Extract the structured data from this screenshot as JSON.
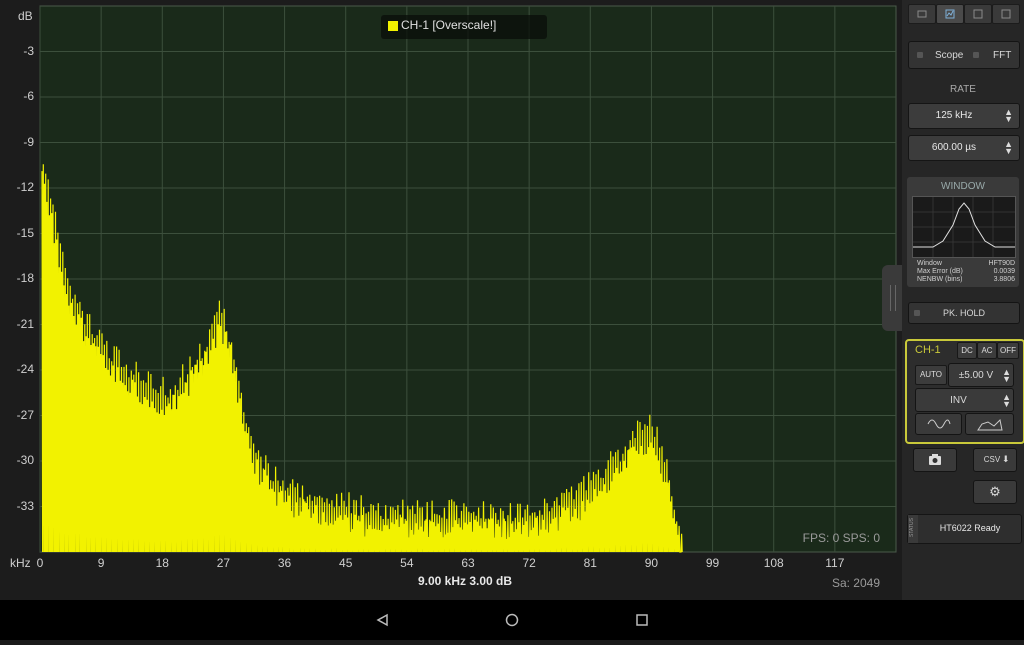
{
  "plot": {
    "y_unit": "dB",
    "x_unit": "kHz",
    "y_ticks": [
      "-3",
      "-6",
      "-9",
      "-12",
      "-15",
      "-18",
      "-21",
      "-24",
      "-27",
      "-30",
      "-33"
    ],
    "x_ticks": [
      "0",
      "9",
      "18",
      "27",
      "36",
      "45",
      "54",
      "63",
      "72",
      "81",
      "90",
      "99",
      "108",
      "117"
    ],
    "legend": "CH-1 [Overscale!]",
    "fps": "FPS: 0  SPS: 0",
    "cursor": "9.00 kHz  3.00 dB",
    "samples": "Sa: 2049",
    "trace_color": "#f2f200",
    "grid_color": "#3c4f3c",
    "background_color": "#1a2a1a"
  },
  "chart_data": {
    "type": "line",
    "xlabel": "kHz",
    "ylabel": "dB",
    "xlim": [
      0,
      126
    ],
    "ylim": [
      -36,
      0
    ],
    "series": [
      {
        "x": [
          0.5,
          2,
          4,
          7,
          10,
          13,
          16,
          19,
          22,
          25,
          26.5,
          28,
          31,
          34,
          37,
          40,
          43,
          46,
          49,
          52,
          55,
          58,
          61,
          64,
          67,
          70,
          73,
          76,
          79,
          82,
          85,
          88,
          89.5,
          91,
          93,
          94.5
        ],
        "y": [
          -9.6,
          -13,
          -17,
          -20,
          -22,
          -23,
          -24,
          -24.5,
          -23,
          -21,
          -19.2,
          -21,
          -28,
          -30,
          -31,
          -31.5,
          -32,
          -32,
          -32.5,
          -32.5,
          -32.5,
          -32.5,
          -32.5,
          -32.5,
          -32.5,
          -32.5,
          -32.5,
          -32,
          -31.5,
          -30,
          -29,
          -27.2,
          -26.8,
          -27.5,
          -31,
          -34.5
        ]
      }
    ]
  },
  "panel": {
    "mode_scope": "Scope",
    "mode_fft": "FFT",
    "rate_label": "RATE",
    "rate_value": "125 kHz",
    "time_value": "600.00 µs",
    "window_title": "WINDOW",
    "window_rows": [
      {
        "label": "Window",
        "value": "HFT90D"
      },
      {
        "label": "Max Error (dB)",
        "value": "0.0039"
      },
      {
        "label": "NENBW (bins)",
        "value": "3.8806"
      }
    ],
    "peak_hold": "PK. HOLD",
    "channel": "CH-1",
    "coupling": [
      "DC",
      "AC",
      "OFF"
    ],
    "auto": "AUTO",
    "range": "±5.00 V",
    "invert": "INV",
    "csv": "CSV",
    "status_side": "STATUS",
    "status": "HT6022 Ready",
    "accent_color": "#c9c93a"
  }
}
